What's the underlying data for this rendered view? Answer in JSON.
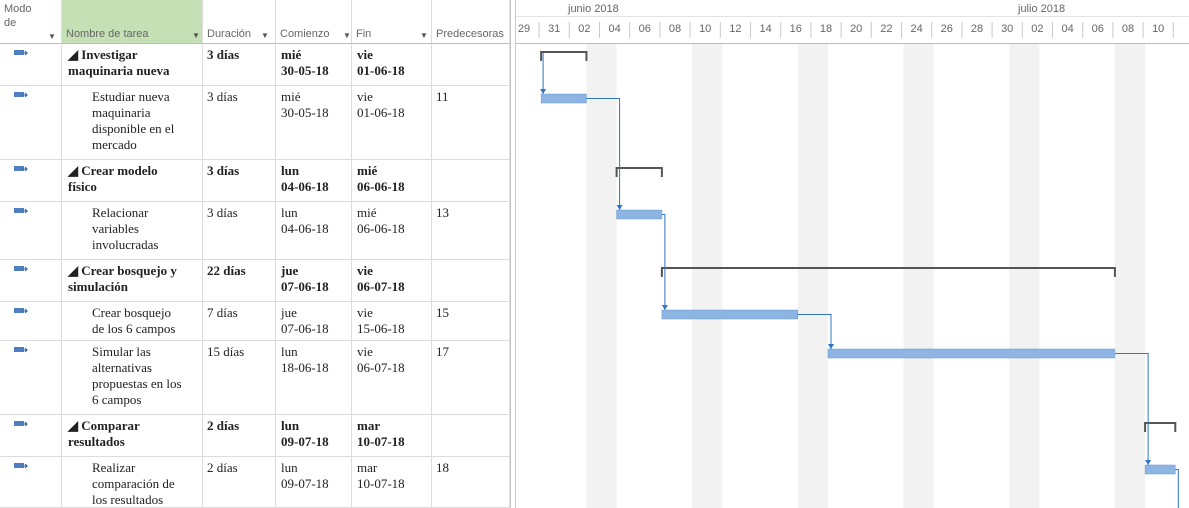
{
  "columns": {
    "mode": "Modo de",
    "name": "Nombre de tarea",
    "duration": "Duración",
    "start": "Comienzo",
    "finish": "Fin",
    "predecessors": "Predecesoras"
  },
  "timeline": {
    "months": [
      "junio 2018",
      "julio 2018"
    ],
    "days": [
      "29",
      "31",
      "02",
      "04",
      "06",
      "08",
      "10",
      "12",
      "14",
      "16",
      "18",
      "20",
      "22",
      "24",
      "26",
      "28",
      "30",
      "02",
      "04",
      "06",
      "08",
      "10"
    ]
  },
  "tasks": [
    {
      "summary": true,
      "name": [
        "◢ Investigar",
        "maquinaria nueva"
      ],
      "duration": "3 días",
      "start": [
        "mié",
        "30-05-18"
      ],
      "finish": [
        "vie",
        "01-06-18"
      ],
      "pred": ""
    },
    {
      "summary": false,
      "name": [
        "Estudiar nueva",
        "maquinaria",
        "disponible en el",
        "mercado"
      ],
      "duration": "3 días",
      "start": [
        "mié",
        "30-05-18"
      ],
      "finish": [
        "vie",
        "01-06-18"
      ],
      "pred": "11"
    },
    {
      "summary": true,
      "name": [
        "◢ Crear modelo",
        "físico"
      ],
      "duration": "3 días",
      "start": [
        "lun",
        "04-06-18"
      ],
      "finish": [
        "mié",
        "06-06-18"
      ],
      "pred": ""
    },
    {
      "summary": false,
      "name": [
        "Relacionar",
        "variables",
        "involucradas"
      ],
      "duration": "3 días",
      "start": [
        "lun",
        "04-06-18"
      ],
      "finish": [
        "mié",
        "06-06-18"
      ],
      "pred": "13"
    },
    {
      "summary": true,
      "name": [
        "◢ Crear bosquejo y",
        "simulación"
      ],
      "duration": "22 días",
      "start": [
        "jue",
        "07-06-18"
      ],
      "finish": [
        "vie",
        "06-07-18"
      ],
      "pred": ""
    },
    {
      "summary": false,
      "name": [
        "Crear bosquejo",
        "de los 6 campos"
      ],
      "duration": "7 días",
      "start": [
        "jue",
        "07-06-18"
      ],
      "finish": [
        "vie",
        "15-06-18"
      ],
      "pred": "15"
    },
    {
      "summary": false,
      "name": [
        "Simular las",
        "alternativas",
        "propuestas en los",
        "6 campos"
      ],
      "duration": "15 días",
      "start": [
        "lun",
        "18-06-18"
      ],
      "finish": [
        "vie",
        "06-07-18"
      ],
      "pred": "17"
    },
    {
      "summary": true,
      "name": [
        "◢ Comparar",
        "resultados"
      ],
      "duration": "2 días",
      "start": [
        "lun",
        "09-07-18"
      ],
      "finish": [
        "mar",
        "10-07-18"
      ],
      "pred": ""
    },
    {
      "summary": false,
      "name": [
        "Realizar",
        "comparación de",
        "los resultados"
      ],
      "duration": "2 días",
      "start": [
        "lun",
        "09-07-18"
      ],
      "finish": [
        "mar",
        "10-07-18"
      ],
      "pred": "18"
    }
  ],
  "colors": {
    "bar": "#8db4e2",
    "bar_edge": "#6a9bd1",
    "link": "#2f75c0",
    "summary": "#555555",
    "weekend": "#f2f2f2",
    "selected_header": "#c5e0b4",
    "mode_icon": "#4f7fc0"
  }
}
